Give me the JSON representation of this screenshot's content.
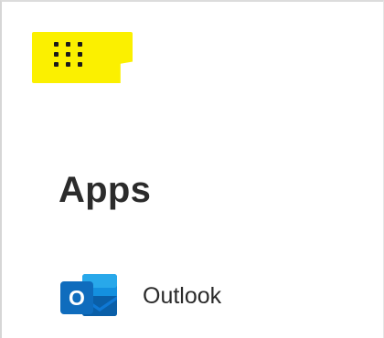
{
  "apps_panel": {
    "launcher_icon": "app-launcher-waffle-icon",
    "highlight_color": "#fbf000",
    "heading": "Apps",
    "items": [
      {
        "label": "Outlook",
        "icon": "outlook-icon",
        "icon_letter": "O",
        "brand_color": "#0f6cbd"
      }
    ]
  }
}
